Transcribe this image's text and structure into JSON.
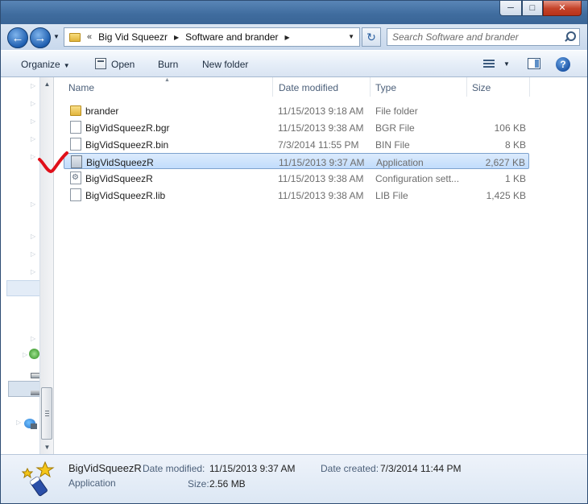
{
  "window": {
    "controls": {
      "minimize": "─",
      "maximize": "□",
      "close": "✕"
    }
  },
  "nav": {
    "breadcrumb": {
      "overflow": "«",
      "items": [
        "Big Vid Squeezr",
        "Software and brander"
      ]
    },
    "search_placeholder": "Search Software and brander"
  },
  "toolbar": {
    "organize": "Organize",
    "open": "Open",
    "burn": "Burn",
    "new_folder": "New folder",
    "help": "?"
  },
  "columns": {
    "name": "Name",
    "date_modified": "Date modified",
    "type": "Type",
    "size": "Size"
  },
  "files": [
    {
      "name": "brander",
      "date": "11/15/2013 9:18 AM",
      "type": "File folder",
      "size": "",
      "icon": "folder-icon"
    },
    {
      "name": "BigVidSqueezR.bgr",
      "date": "11/15/2013 9:38 AM",
      "type": "BGR File",
      "size": "106 KB",
      "icon": "document-icon"
    },
    {
      "name": "BigVidSqueezR.bin",
      "date": "7/3/2014 11:55 PM",
      "type": "BIN File",
      "size": "8 KB",
      "icon": "document-icon"
    },
    {
      "name": "BigVidSqueezR",
      "date": "11/15/2013 9:37 AM",
      "type": "Application",
      "size": "2,627 KB",
      "icon": "application-icon",
      "selected": true
    },
    {
      "name": "BigVidSqueezR",
      "date": "11/15/2013 9:38 AM",
      "type": "Configuration sett...",
      "size": "1 KB",
      "icon": "config-file-icon"
    },
    {
      "name": "BigVidSqueezR.lib",
      "date": "11/15/2013 9:38 AM",
      "type": "LIB File",
      "size": "1,425 KB",
      "icon": "document-icon"
    }
  ],
  "details": {
    "name": "BigVidSqueezR",
    "type": "Application",
    "date_modified_label": "Date modified:",
    "date_modified": "11/15/2013 9:37 AM",
    "date_created_label": "Date created:",
    "date_created": "7/3/2014 11:44 PM",
    "size_label": "Size:",
    "size": "2.56 MB"
  },
  "colors": {
    "selection": "#c1dcfc",
    "annotation": "#e0101a",
    "title_bar": "#3f6c9e"
  }
}
